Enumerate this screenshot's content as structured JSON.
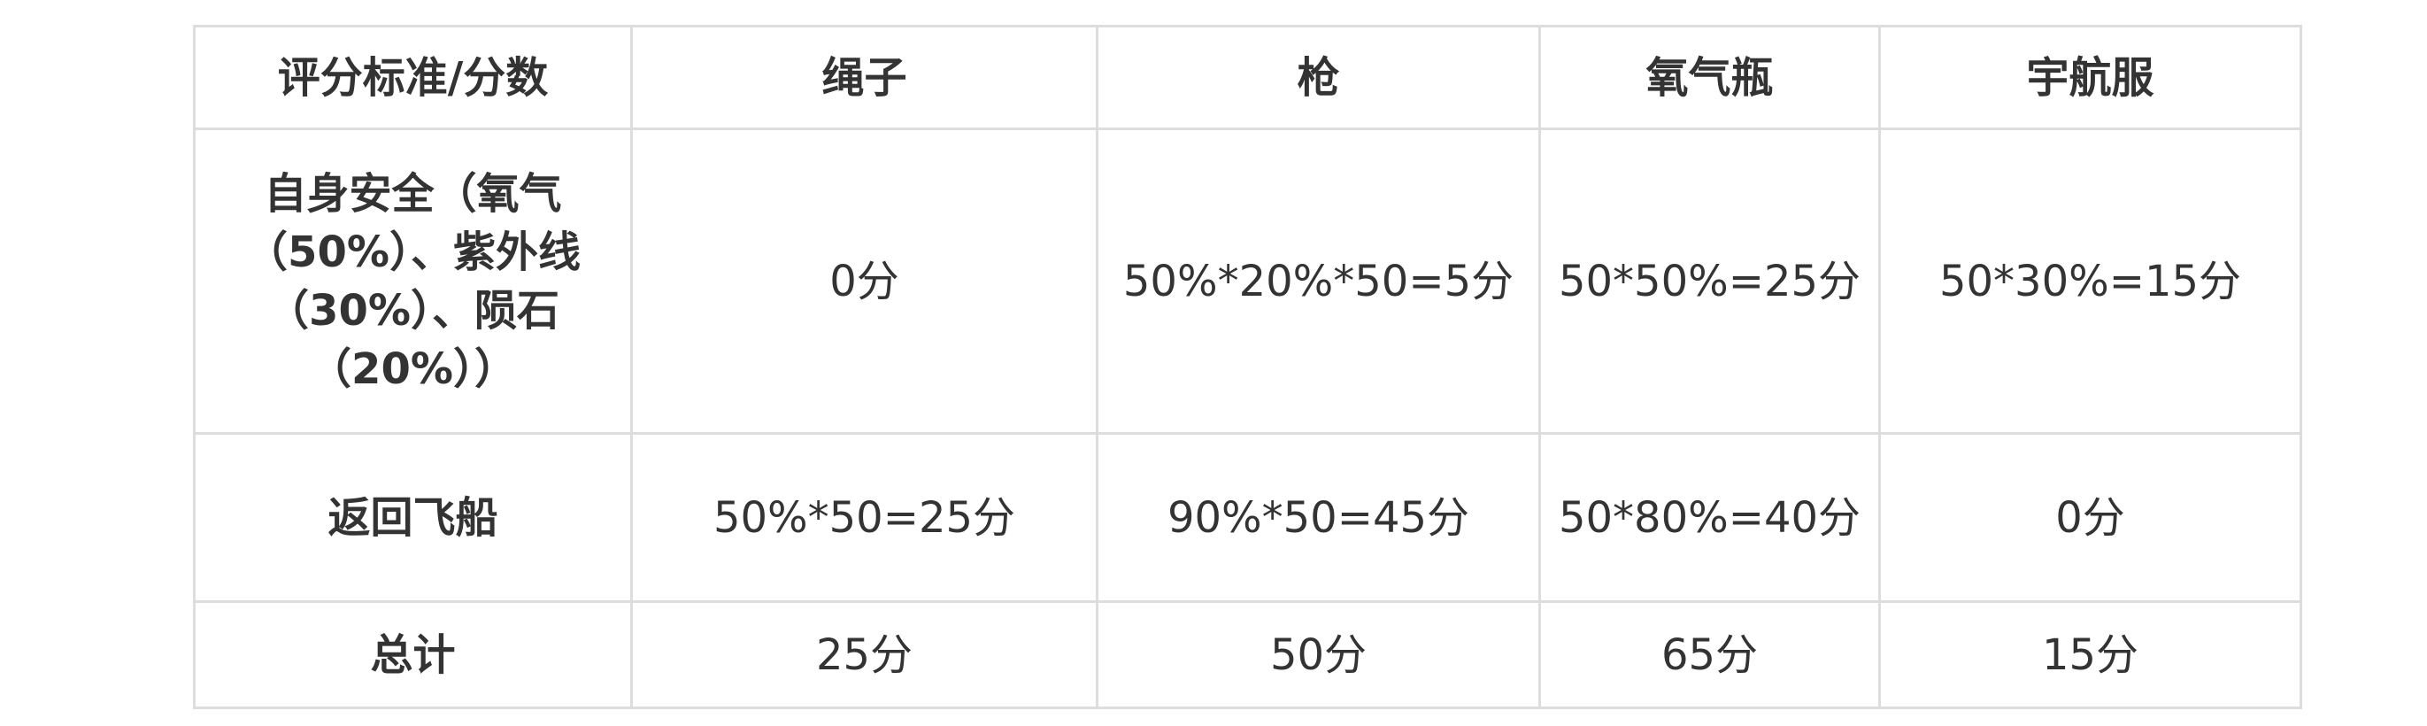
{
  "table": {
    "headers": [
      "评分标准/分数",
      "绳子",
      "枪",
      "氧气瓶",
      "宇航服"
    ],
    "rows": [
      {
        "label": "自身安全（氧气（50%）、紫外线（30%）、陨石（20%））",
        "cells": [
          "0分",
          "50%*20%*50=5分",
          "50*50%=25分",
          "50*30%=15分"
        ]
      },
      {
        "label": "返回飞船",
        "cells": [
          "50%*50=25分",
          "90%*50=45分",
          "50*80%=40分",
          "0分"
        ]
      },
      {
        "label": "总计",
        "cells": [
          "25分",
          "50分",
          "65分",
          "15分"
        ]
      }
    ]
  }
}
